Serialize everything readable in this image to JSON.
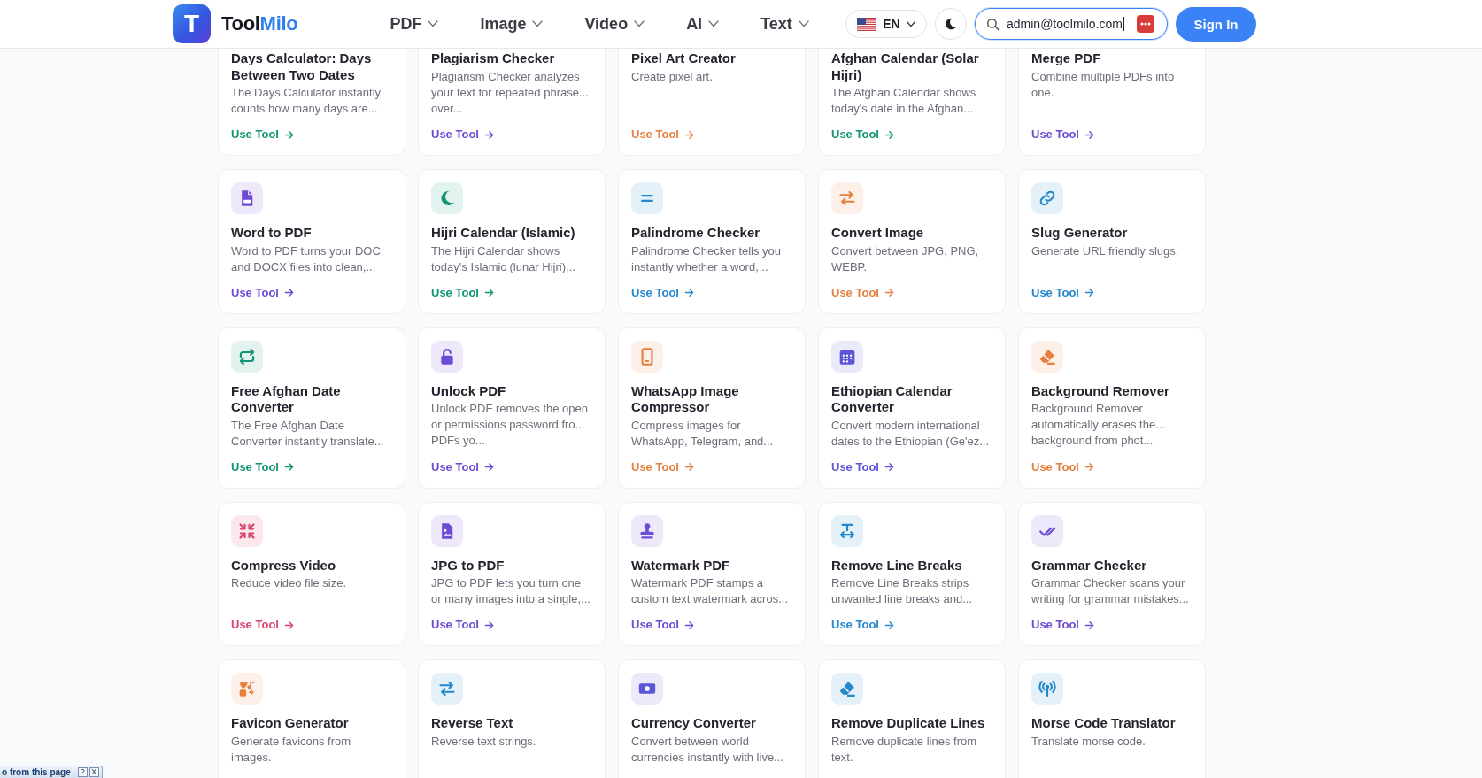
{
  "header": {
    "logo": {
      "mark": "T",
      "name": "Tool",
      "name_accent": "Milo"
    },
    "nav": [
      {
        "label": "PDF"
      },
      {
        "label": "Image"
      },
      {
        "label": "Video"
      },
      {
        "label": "AI"
      },
      {
        "label": "Text"
      }
    ],
    "language": {
      "label": "EN"
    },
    "search": {
      "value": "admin@toolmilo.com",
      "focused": true
    },
    "sign_in": "Sign In"
  },
  "tool_grid": {
    "top_row_cut": [
      {
        "title": "Days Calculator: Days Between Two Dates",
        "description": "The Days Calculator instantly counts how many days are...",
        "link": "Use Tool",
        "color": "#119474"
      },
      {
        "title": "Plagiarism Checker",
        "description": "Plagiarism Checker analyzes your text for repeated phrase... over...",
        "link": "Use Tool",
        "color": "#6d4bd4"
      },
      {
        "title": "Pixel Art Creator",
        "description": "Create pixel art.",
        "link": "Use Tool",
        "color": "#e5803f"
      },
      {
        "title": "Afghan Calendar (Solar Hijri)",
        "description": "The Afghan Calendar shows today's date in the Afghan...",
        "link": "Use Tool",
        "color": "#119474"
      },
      {
        "title": "Merge PDF",
        "description": "Combine multiple PDFs into one.",
        "link": "Use Tool",
        "color": "#6d4bd4"
      }
    ],
    "cards": [
      {
        "title": "Word to PDF",
        "description": "Word to PDF turns your DOC and DOCX files into clean,...",
        "link": "Use Tool",
        "color": "#6d4bd4"
      },
      {
        "title": "Hijri Calendar (Islamic)",
        "description": "The Hijri Calendar shows today's Islamic (lunar Hijri)...",
        "link": "Use Tool",
        "color": "#119474"
      },
      {
        "title": "Palindrome Checker",
        "description": "Palindrome Checker tells you instantly whether a word,...",
        "link": "Use Tool",
        "color": "#2688cc"
      },
      {
        "title": "Convert Image",
        "description": "Convert between JPG, PNG, WEBP.",
        "link": "Use Tool",
        "color": "#e5803f"
      },
      {
        "title": "Slug Generator",
        "description": "Generate URL friendly slugs.",
        "link": "Use Tool",
        "color": "#2688cc"
      },
      {
        "title": "Free Afghan Date Converter",
        "description": "The Free Afghan Date Converter instantly translate...",
        "link": "Use Tool",
        "color": "#119474"
      },
      {
        "title": "Unlock PDF",
        "description": "Unlock PDF removes the open or permissions password fro... PDFs yo...",
        "link": "Use Tool",
        "color": "#6d4bd4"
      },
      {
        "title": "WhatsApp Image Compressor",
        "description": "Compress images for WhatsApp, Telegram, and...",
        "link": "Use Tool",
        "color": "#e5803f"
      },
      {
        "title": "Ethiopian Calendar Converter",
        "description": "Convert modern international dates to the Ethiopian (Ge'ez...",
        "link": "Use Tool",
        "color": "#5b55d8"
      },
      {
        "title": "Background Remover",
        "description": "Background Remover automatically erases the... background from phot...",
        "link": "Use Tool",
        "color": "#e5803f"
      },
      {
        "title": "Compress Video",
        "description": "Reduce video file size.",
        "link": "Use Tool",
        "color": "#d9456b"
      },
      {
        "title": "JPG to PDF",
        "description": "JPG to PDF lets you turn one or many images into a single,...",
        "link": "Use Tool",
        "color": "#6d4bd4"
      },
      {
        "title": "Watermark PDF",
        "description": "Watermark PDF stamps a custom text watermark acros...",
        "link": "Use Tool",
        "color": "#6d4bd4"
      },
      {
        "title": "Remove Line Breaks",
        "description": "Remove Line Breaks strips unwanted line breaks and...",
        "link": "Use Tool",
        "color": "#2688cc"
      },
      {
        "title": "Grammar Checker",
        "description": "Grammar Checker scans your writing for grammar mistakes...",
        "link": "Use Tool",
        "color": "#6d4bd4"
      },
      {
        "title": "Favicon Generator",
        "description": "Generate favicons from images.",
        "color": "#e5803f"
      },
      {
        "title": "Reverse Text",
        "description": "Reverse text strings.",
        "color": "#2688cc"
      },
      {
        "title": "Currency Converter",
        "description": "Convert between world currencies instantly with live...",
        "color": "#5b55d8"
      },
      {
        "title": "Remove Duplicate Lines",
        "description": "Remove duplicate lines from text.",
        "color": "#2688cc"
      },
      {
        "title": "Morse Code Translator",
        "description": "Translate morse code.",
        "color": "#2688cc"
      }
    ]
  },
  "translate_bar": {
    "text": "o from this page",
    "buttons": [
      "?",
      "X"
    ]
  }
}
